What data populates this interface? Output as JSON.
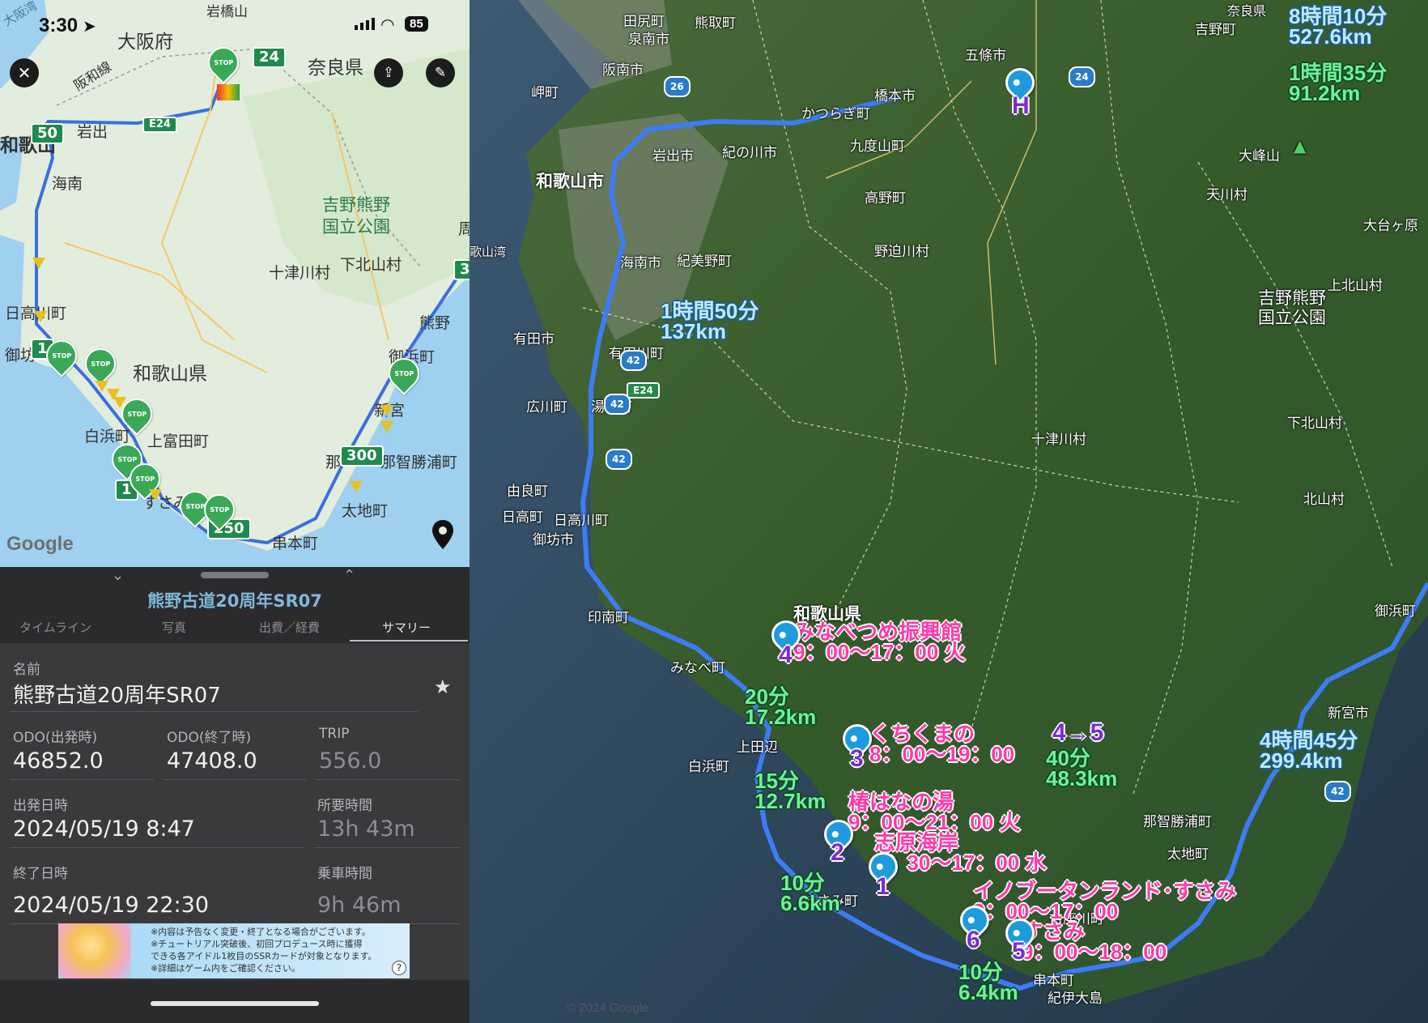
{
  "status_bar": {
    "time": "3:30",
    "battery": "85"
  },
  "left_map": {
    "labels": {
      "osaka_bay": "大阪湾",
      "iwahashi": "岩橋山",
      "osaka_pref": "大阪府",
      "nara_pref": "奈良県",
      "hanwa": "阪和線",
      "iwade": "岩出",
      "wakayama": "和歌山",
      "kainan": "海南",
      "yoshino_park": "吉野熊野\n国立公園",
      "totsukawa": "十津川村",
      "shimokitayama": "下北山村",
      "hidakagawa": "日高川町",
      "gobo": "御坊",
      "wakayama_pref": "和歌山県",
      "kumano": "熊野",
      "mihama": "御浜町",
      "shingu": "新宮",
      "shirahama": "白浜町",
      "kamitonda": "上富田町",
      "susami": "すさみ",
      "nachikatsuura": "那智勝浦町",
      "taiji": "太地町",
      "kushimoto": "串本町",
      "shu": "周",
      "nachi": "那"
    },
    "road_shields": [
      "24",
      "E24",
      "50",
      "300",
      "250",
      "3",
      "1",
      "1"
    ],
    "stop_label": "STOP",
    "google_logo": "Google"
  },
  "sheet": {
    "trip_title": "熊野古道20周年SR07",
    "tabs": [
      "タイムライン",
      "写真",
      "出費／経費",
      "サマリー"
    ],
    "name_label": "名前",
    "name_value": "熊野古道20周年SR07",
    "odo_start_label": "ODO(出発時)",
    "odo_start_value": "46852.0",
    "odo_end_label": "ODO(終了時)",
    "odo_end_value": "47408.0",
    "trip_label": "TRIP",
    "trip_value": "556.0",
    "depart_label": "出発日時",
    "depart_value": "2024/05/19 8:47",
    "duration_label": "所要時間",
    "duration_value": "13h 43m",
    "end_label": "終了日時",
    "end_value": "2024/05/19 22:30",
    "ride_label": "乗車時間",
    "ride_value": "9h 46m",
    "ad_lines": [
      "※内容は予告なく変更・終了となる場合がございます。",
      "※チュートリアル突破後、初回プロデュース時に獲得",
      "できる各アイドル1枚目のSSRカードが対象となります。",
      "※詳細はゲーム内をご確認ください。"
    ]
  },
  "right_map": {
    "labels": {
      "tajiri": "田尻町",
      "kumatori": "熊取町",
      "izumisano": "泉南市",
      "hannan": "阪南市",
      "misaki": "岬町",
      "wakayama_city": "和歌山市",
      "iwade_city": "岩出市",
      "kinokawa": "紀の川市",
      "katsuragi": "かつらぎ町",
      "hashimoto": "橋本市",
      "kudoyama": "九度山町",
      "koya": "高野町",
      "gojo": "五條市",
      "yoshino_bay": "歌山湾",
      "kainan_city": "海南市",
      "kimino": "紀美野町",
      "nosegawa": "野迫川村",
      "arida": "有田市",
      "aridagawa": "有田川町",
      "hirogawa": "広川町",
      "yuasa": "湯浅町",
      "yura": "由良町",
      "hidaka": "日高町",
      "hidakagawa2": "日高川町",
      "gobo_city": "御坊市",
      "inami": "印南町",
      "mina": "みなべ町",
      "wakayama_pref2": "和歌山県",
      "tanabe": "上田辺",
      "shirahama2": "白浜町",
      "susami2": "すさみ町",
      "kozagawa": "古座川町",
      "kushimoto2": "串本町",
      "oshima": "紀伊大島",
      "taiji2": "太地町",
      "nachikatsuura2": "那智勝浦町",
      "shingu2": "新宮市",
      "mihama2": "御浜町",
      "totsukawa2": "十津川村",
      "shimokitayama2": "下北山村",
      "kitayama": "北山村",
      "kamikitayama": "上北山村",
      "yoshino_park2": "吉野熊野\n国立公園",
      "omine": "大峰山",
      "tenkawa": "天川村",
      "odaigahara": "大台ヶ原",
      "yoshino": "吉野町",
      "narapref": "奈良県"
    },
    "roads": [
      "26",
      "24",
      "42",
      "42",
      "42",
      "E24",
      "42"
    ],
    "annotations": {
      "total": "8時間10分\n527.6km",
      "leg_h": "1時間35分\n91.2km",
      "leg_1": "1時間50分\n137km",
      "leg_4": "20分\n17.2km",
      "leg_3": "15分\n12.7km",
      "leg_2": "10分\n6.6km",
      "leg_6": "10分\n6.4km",
      "leg_45": "40分\n48.3km",
      "leg_end": "4時間45分\n299.4km",
      "mark_45": "4→5"
    },
    "pois": {
      "poi4": "みなべつめ振興館\n9：00〜17：00 火",
      "poi3": "くちくまの\n8：00〜19：00",
      "poi_tsubaki": "椿はなの湯\n9：00〜21：00 火",
      "poi_shihara": "志原海岸\n8：30〜17：00 水",
      "poi_inobuta": "イノブータンランド･すさみ\n9：00〜17：00",
      "poi5": "すさみ\n9：00〜18：00"
    },
    "pin_labels": [
      "H",
      "1",
      "2",
      "3",
      "4",
      "5",
      "6"
    ],
    "copyright": "© 2024 Google"
  },
  "colors": {
    "route": "#2f7bf6",
    "pin": "#1d9bdc",
    "pink": "#ff3aa8",
    "purple": "#7b2bd6"
  }
}
